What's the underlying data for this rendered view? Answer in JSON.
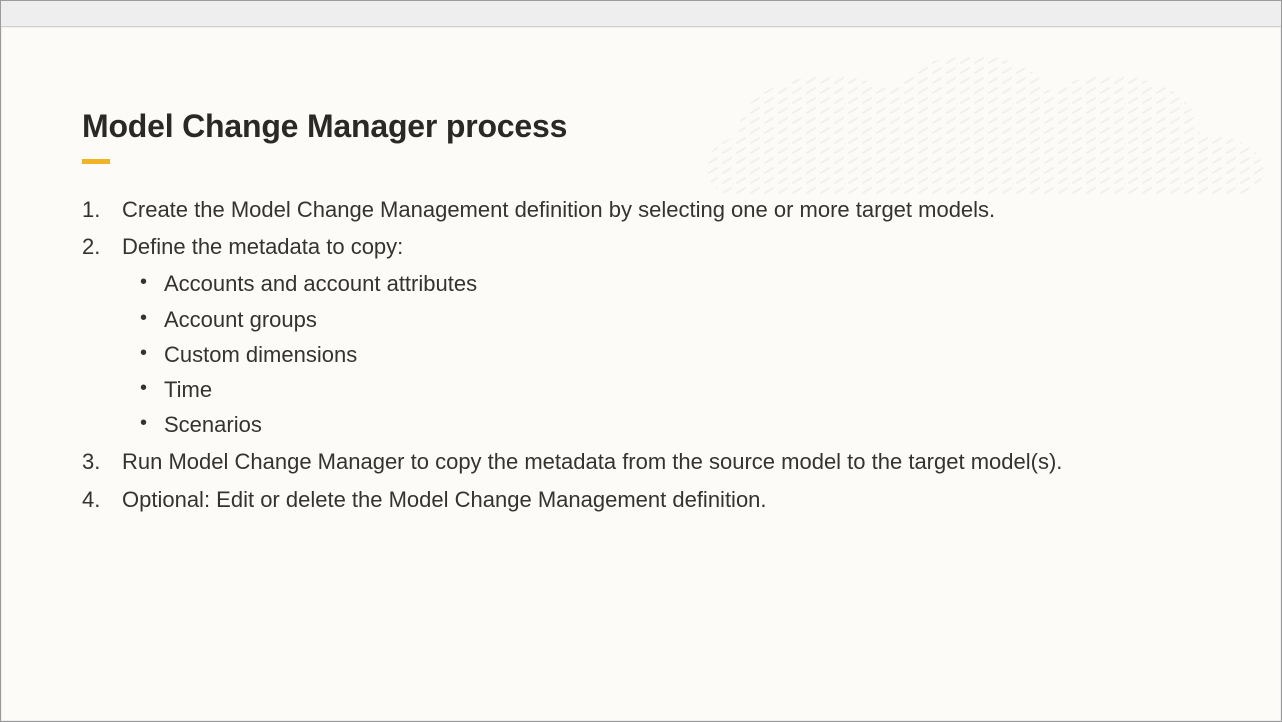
{
  "title": "Model Change Manager process",
  "steps": [
    {
      "text": "Create the Model Change Management definition by selecting one or more target models."
    },
    {
      "text": "Define the metadata to copy:",
      "sub": [
        "Accounts and account attributes",
        "Account groups",
        "Custom dimensions",
        "Time",
        "Scenarios"
      ]
    },
    {
      "text": "Run Model Change Manager to copy the metadata from the source model to the target model(s)."
    },
    {
      "text": "Optional: Edit or delete the Model Change Management definition."
    }
  ]
}
